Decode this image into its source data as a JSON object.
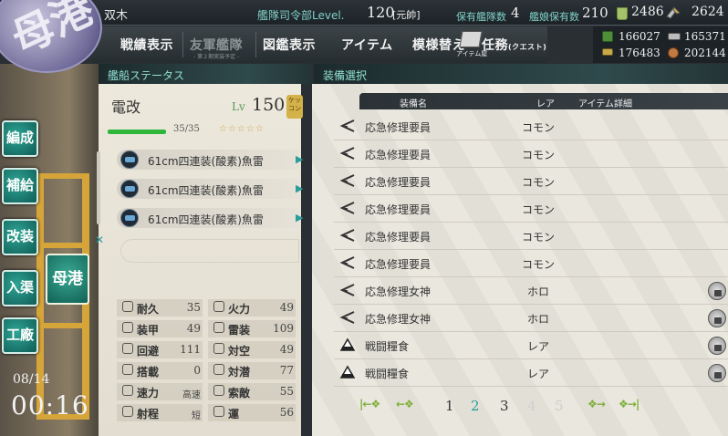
{
  "admiral": {
    "name": "双木",
    "hq_label": "艦隊司令部Level.",
    "hq_level": "120",
    "rank": "[元帥]",
    "ships_label": "保有艦隊数",
    "ships_count": "4",
    "equip_label": "艦娘保有数",
    "equip_count": "210",
    "buckets": "2486",
    "devmats": "2624"
  },
  "emblem": "母港",
  "menu": {
    "record": "戦績表示",
    "friend_fleet": "友軍艦隊",
    "friend_fleet_sub": "- 第２期実装予定 -",
    "library": "図鑑表示",
    "items": "アイテム",
    "furniture": "模様替え",
    "quests": "任務",
    "quests_small": "(クエスト)",
    "shop": "アイテム屋"
  },
  "resources": {
    "fuel": "166027",
    "steel": "165371",
    "ammo": "176483",
    "bauxite": "202144"
  },
  "side_nav": [
    "編成",
    "補給",
    "改装",
    "入渠",
    "工廠"
  ],
  "side_nav_current": "母港",
  "clock": {
    "date": "08/14",
    "time": "00:16"
  },
  "sections": {
    "ship_status": "艦船ステータス",
    "equip_select": "装備選択"
  },
  "ship": {
    "name": "電改",
    "lv_label": "Lv",
    "level": "150",
    "hp": "35/35",
    "stars": "☆☆☆☆☆",
    "marriage": "ケッコン",
    "slots": [
      "61cm四連装(酸素)魚雷",
      "61cm四連装(酸素)魚雷",
      "61cm四連装(酸素)魚雷"
    ],
    "stats": [
      {
        "label": "耐久",
        "value": "35",
        "label2": "火力",
        "value2": "49"
      },
      {
        "label": "装甲",
        "value": "49",
        "label2": "雷装",
        "value2": "109"
      },
      {
        "label": "回避",
        "value": "111",
        "label2": "対空",
        "value2": "49"
      },
      {
        "label": "搭載",
        "value": "0",
        "label2": "対潜",
        "value2": "77"
      },
      {
        "label": "速力",
        "value": "高速",
        "label2": "索敵",
        "value2": "55"
      },
      {
        "label": "射程",
        "value": "短",
        "label2": "運",
        "value2": "56"
      }
    ]
  },
  "equip_table": {
    "headers": {
      "name": "装備名",
      "rarity": "レア",
      "detail": "アイテム詳細"
    },
    "rows": [
      {
        "name": "応急修理要員",
        "rarity": "コモン",
        "icon": "repair-crew-icon",
        "locked": false
      },
      {
        "name": "応急修理要員",
        "rarity": "コモン",
        "icon": "repair-crew-icon",
        "locked": false
      },
      {
        "name": "応急修理要員",
        "rarity": "コモン",
        "icon": "repair-crew-icon",
        "locked": false
      },
      {
        "name": "応急修理要員",
        "rarity": "コモン",
        "icon": "repair-crew-icon",
        "locked": false
      },
      {
        "name": "応急修理要員",
        "rarity": "コモン",
        "icon": "repair-crew-icon",
        "locked": false
      },
      {
        "name": "応急修理要員",
        "rarity": "コモン",
        "icon": "repair-crew-icon",
        "locked": false
      },
      {
        "name": "応急修理女神",
        "rarity": "ホロ",
        "icon": "repair-goddess-icon",
        "locked": true
      },
      {
        "name": "応急修理女神",
        "rarity": "ホロ",
        "icon": "repair-goddess-icon",
        "locked": true
      },
      {
        "name": "戦闘糧食",
        "rarity": "レア",
        "icon": "ration-icon",
        "locked": true
      },
      {
        "name": "戦闘糧食",
        "rarity": "レア",
        "icon": "ration-icon",
        "locked": true
      }
    ]
  },
  "pager": {
    "pages": [
      "1",
      "2",
      "3",
      "4",
      "5"
    ],
    "current": "2"
  },
  "colors": {
    "accent": "#2a9d9a",
    "header_text": "#7fcfc6",
    "hp_bar": "#2eb73b",
    "girder": "#d6a53a"
  }
}
